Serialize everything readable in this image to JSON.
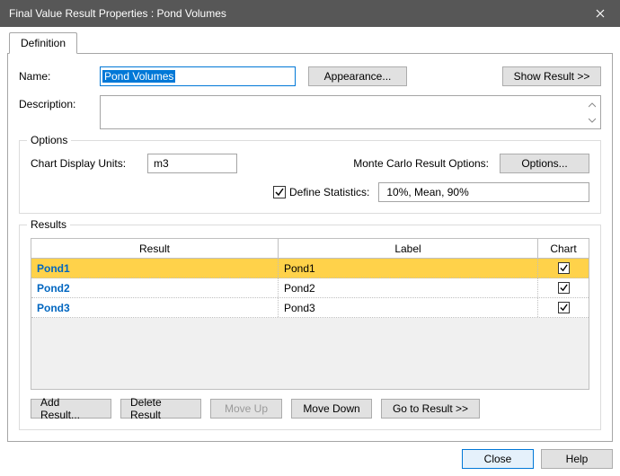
{
  "window": {
    "title": "Final Value Result Properties : Pond Volumes"
  },
  "tabs": {
    "definition": "Definition"
  },
  "form": {
    "name_label": "Name:",
    "name_value": "Pond Volumes",
    "appearance_btn": "Appearance...",
    "show_result_btn": "Show Result >>",
    "desc_label": "Description:"
  },
  "options": {
    "legend": "Options",
    "chart_units_label": "Chart Display Units:",
    "chart_units_value": "m3",
    "mc_label": "Monte Carlo Result Options:",
    "mc_btn": "Options...",
    "define_stats_label": "Define Statistics:",
    "define_stats_checked": true,
    "stats_value": "10%, Mean, 90%"
  },
  "results": {
    "legend": "Results",
    "headers": {
      "result": "Result",
      "label": "Label",
      "chart": "Chart"
    },
    "rows": [
      {
        "result": "Pond1",
        "label": "Pond1",
        "chart": true,
        "selected": true
      },
      {
        "result": "Pond2",
        "label": "Pond2",
        "chart": true,
        "selected": false
      },
      {
        "result": "Pond3",
        "label": "Pond3",
        "chart": true,
        "selected": false
      }
    ],
    "buttons": {
      "add": "Add Result...",
      "delete": "Delete Result",
      "move_up": "Move Up",
      "move_down": "Move Down",
      "goto": "Go to Result >>"
    }
  },
  "footer": {
    "close": "Close",
    "help": "Help"
  }
}
